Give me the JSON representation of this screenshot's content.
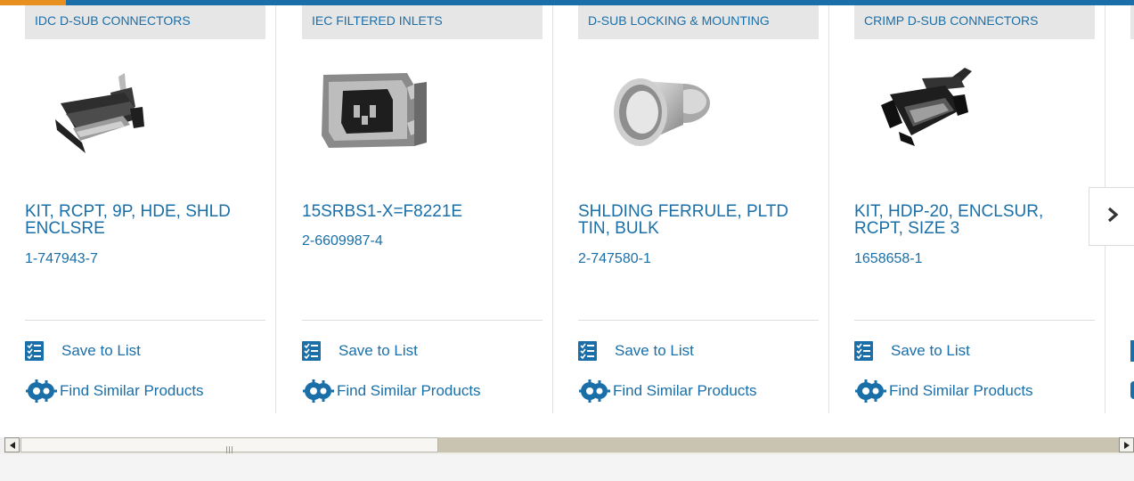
{
  "progress": {
    "fraction": 0.058
  },
  "cards": [
    {
      "category": "IDC D-SUB CONNECTORS",
      "image": "idc-dsub-connector-image",
      "title": "KIT, RCPT, 9P, HDE, SHLD ENCLSRE",
      "part_number": "1-747943-7",
      "save_label": "Save to List",
      "similar_label": "Find Similar Products"
    },
    {
      "category": "IEC FILTERED INLETS",
      "image": "iec-filtered-inlet-image",
      "title": "15SRBS1-X=F8221E",
      "part_number": "2-6609987-4",
      "save_label": "Save to List",
      "similar_label": "Find Similar Products"
    },
    {
      "category": "D-SUB LOCKING & MOUNTING",
      "image": "shielding-ferrule-image",
      "title": "SHLDING FERRULE, PLTD TIN, BULK",
      "part_number": "2-747580-1",
      "save_label": "Save to List",
      "similar_label": "Find Similar Products"
    },
    {
      "category": "CRIMP D-SUB CONNECTORS",
      "image": "crimp-dsub-connector-image",
      "title": "KIT, HDP-20, ENCLSUR, RCPT, SIZE 3",
      "part_number": "1658658-1",
      "save_label": "Save to List",
      "similar_label": "Find Similar Products"
    }
  ],
  "icons": {
    "save": "checklist-icon",
    "similar": "gears-icon",
    "next": "chevron-right-icon",
    "scroll_left": "arrow-left-icon",
    "scroll_right": "arrow-right-icon"
  },
  "colors": {
    "link": "#1a6fa8",
    "category_bg": "#e6e6e6",
    "progress_track": "#1a6fa8",
    "progress_fill": "#e8901f"
  },
  "scrollbar": {
    "position_fraction": 0.0,
    "visible_fraction": 0.38
  }
}
